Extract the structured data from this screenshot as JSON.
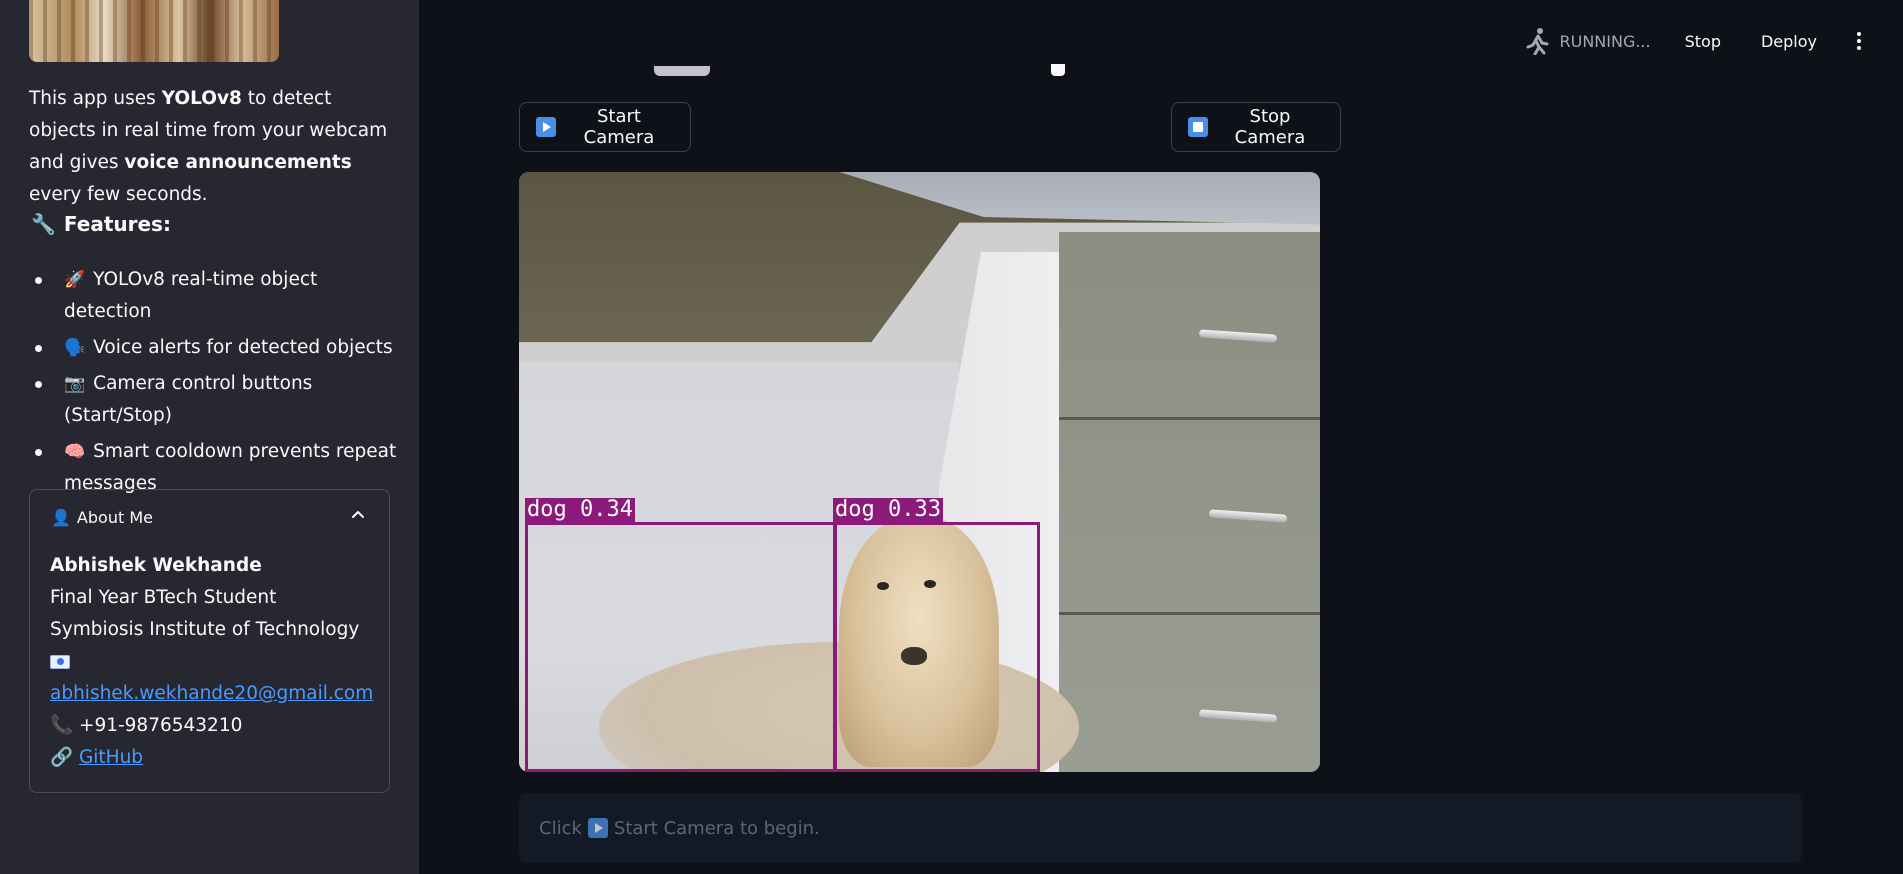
{
  "sidebar": {
    "intro": {
      "p1": "This app uses ",
      "b1": "YOLOv8",
      "p2": " to detect objects in real time from your webcam and gives ",
      "b2": "voice announcements",
      "p3": " every few seconds."
    },
    "features_icon": "🔧",
    "features_heading": "Features:",
    "features": [
      {
        "emoji": "🚀",
        "text": "YOLOv8 real-time object detection"
      },
      {
        "emoji": "🗣️",
        "text": "Voice alerts for detected objects"
      },
      {
        "emoji": "📷",
        "text": "Camera control buttons (Start/Stop)"
      },
      {
        "emoji": "🧠",
        "text": "Smart cooldown prevents repeat messages"
      }
    ],
    "about": {
      "icon": "👤",
      "title": "About Me",
      "name": "Abhishek Wekhande",
      "line2": "Final Year BTech Student",
      "line3": "Symbiosis Institute of Technology",
      "email": "abhishek.wekhande20@gmail.com",
      "phone_icon": "📞",
      "phone": "+91-9876543210",
      "github_icon": "🔗",
      "github": "GitHub"
    }
  },
  "toolbar": {
    "status": "RUNNING...",
    "stop": "Stop",
    "deploy": "Deploy"
  },
  "main": {
    "start_button": "Start Camera",
    "stop_button": "Stop Camera",
    "detections": [
      {
        "label": "dog 0.34"
      },
      {
        "label": "dog 0.33"
      }
    ],
    "info_prefix": "Click",
    "info_suffix": "Start Camera to begin."
  }
}
